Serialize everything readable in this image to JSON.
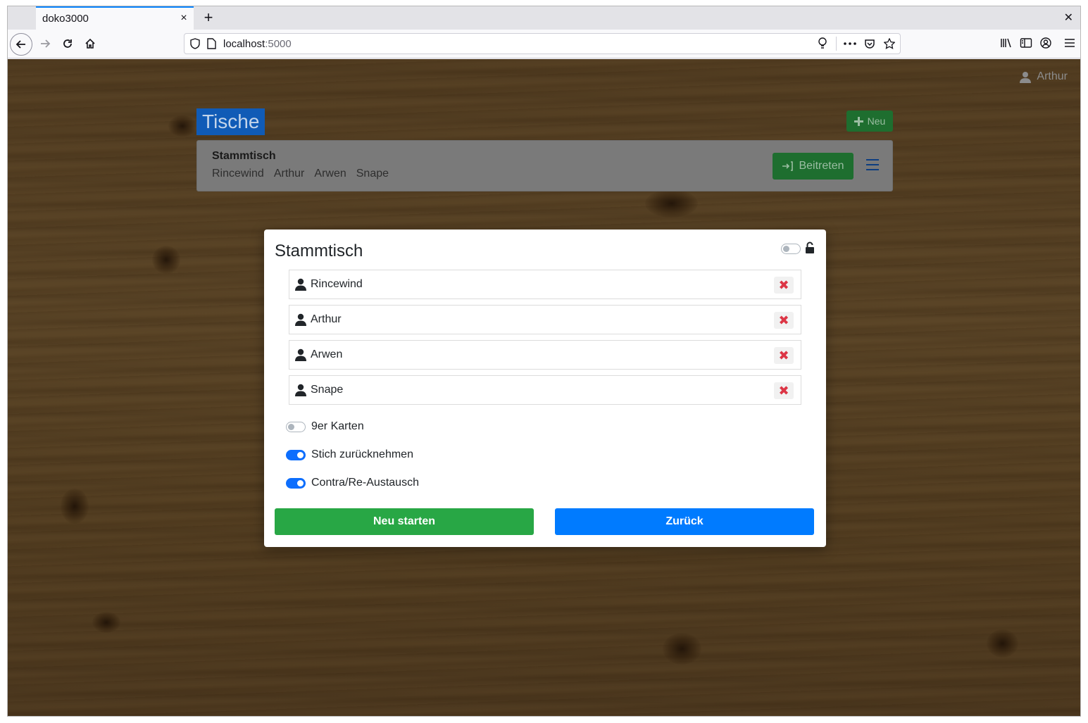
{
  "browser": {
    "tab_title": "doko3000",
    "tab_close": "×",
    "new_tab": "+",
    "window_close": "✕",
    "url_host": "localhost",
    "url_port": ":5000"
  },
  "header": {
    "user_name": "Arthur"
  },
  "main": {
    "title": "Tische",
    "new_label": "Neu",
    "table": {
      "name": "Stammtisch",
      "players": [
        "Rincewind",
        "Arthur",
        "Arwen",
        "Snape"
      ],
      "join_label": "Beitreten"
    }
  },
  "modal": {
    "title": "Stammtisch",
    "lock_toggle_on": false,
    "players": [
      "Rincewind",
      "Arthur",
      "Arwen",
      "Snape"
    ],
    "remove_symbol": "✖",
    "options": [
      {
        "label": "9er Karten",
        "on": false
      },
      {
        "label": "Stich zurücknehmen",
        "on": true
      },
      {
        "label": "Contra/Re-Austausch",
        "on": true
      }
    ],
    "start_label": "Neu starten",
    "back_label": "Zurück"
  },
  "colors": {
    "accent": "#007bff",
    "success": "#28a745",
    "danger": "#dc3545"
  }
}
